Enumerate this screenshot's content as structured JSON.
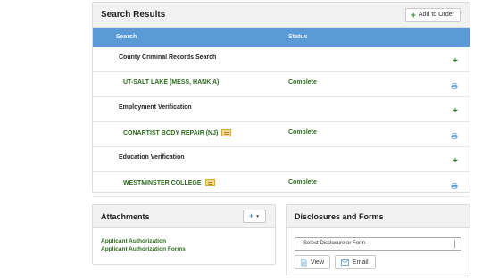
{
  "results": {
    "title": "Search Results",
    "add_label": "Add to Order",
    "col_search": "Search",
    "col_status": "Status",
    "rows": [
      {
        "category": "County Criminal Records Search",
        "item": "UT-SALT LAKE (MESS, HANK A)",
        "status": "Complete",
        "has_note": false
      },
      {
        "category": "Employment Verification",
        "item": "CONARTIST BODY REPAIR (NJ)",
        "status": "Complete",
        "has_note": true
      },
      {
        "category": "Education Verification",
        "item": "WESTMINSTER COLLEGE",
        "status": "Complete",
        "has_note": true
      }
    ]
  },
  "attachments": {
    "title": "Attachments",
    "items": [
      "Applicant Authorization",
      "Applicant Authorization Forms"
    ]
  },
  "disclosures": {
    "title": "Disclosures and Forms",
    "select_value": "--Select Disclosure or Form--",
    "view_label": "View",
    "email_label": "Email"
  },
  "colors": {
    "accent": "#5b9bd5",
    "status_green": "#2f6b1f",
    "plus_green": "#2a8a2a"
  }
}
